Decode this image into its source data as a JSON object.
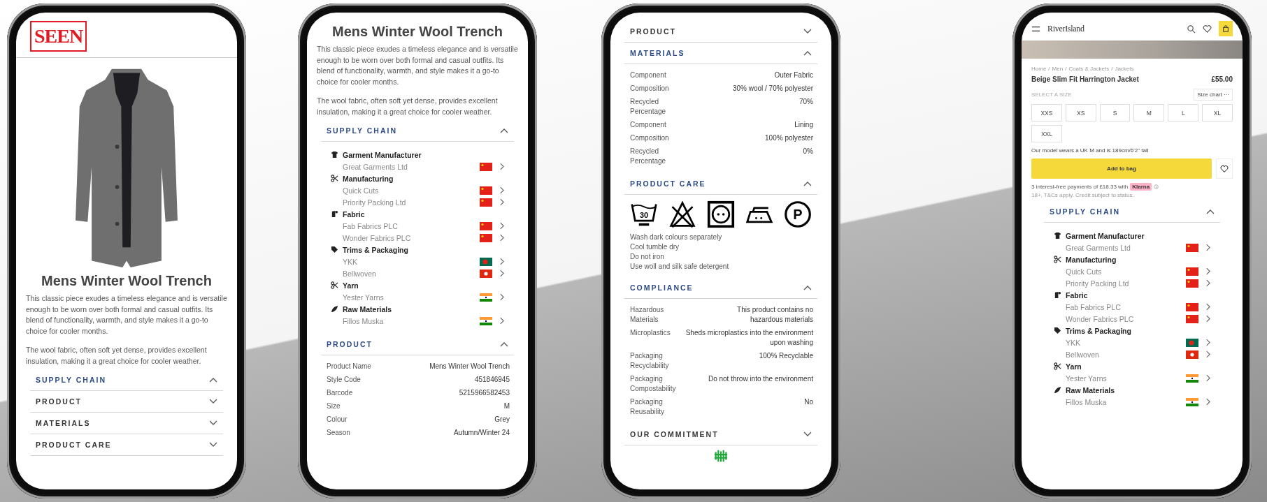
{
  "phones": [
    {
      "blocks": [
        {
          "kind": "logo_header",
          "logo": "SEEN"
        },
        {
          "kind": "coat"
        },
        {
          "kind": "title",
          "text": "Mens Winter Wool Trench"
        },
        {
          "kind": "paragraphs",
          "items": [
            "This classic piece exudes a timeless elegance and is versatile enough to be worn over both formal and casual outfits. Its blend of functionality, warmth, and style makes it a go-to choice for cooler months.",
            "The wool fabric, often soft yet dense, provides excellent insulation, making it a great choice for cooler weather."
          ]
        },
        {
          "kind": "section",
          "title": "SUPPLY CHAIN",
          "expanded": true
        },
        {
          "kind": "section",
          "title": "PRODUCT",
          "expanded": false
        },
        {
          "kind": "section",
          "title": "MATERIALS",
          "expanded": false
        },
        {
          "kind": "section",
          "title": "PRODUCT CARE",
          "expanded": false
        }
      ]
    },
    {
      "blocks": [
        {
          "kind": "title",
          "text": "Mens Winter Wool Trench"
        },
        {
          "kind": "paragraphs",
          "items": [
            "This classic piece exudes a timeless elegance and is versatile enough to be worn over both formal and casual outfits. Its blend of functionality, warmth, and style makes it a go-to choice for cooler months.",
            "The wool fabric, often soft yet dense, provides excellent insulation, making it a great choice for cooler weather."
          ]
        },
        {
          "kind": "section",
          "title": "SUPPLY CHAIN",
          "expanded": true,
          "content": {
            "kind": "supply_chain",
            "groups": [
              {
                "kind": "garment",
                "name": "Garment Manufacturer",
                "suppliers": [
                  {
                    "name": "Great Garments Ltd",
                    "kind": "china"
                  }
                ]
              },
              {
                "kind": "scissors",
                "name": "Manufacturing",
                "suppliers": [
                  {
                    "name": "Quick Cuts",
                    "kind": "china"
                  },
                  {
                    "name": "Priority Packing Ltd",
                    "kind": "china"
                  }
                ]
              },
              {
                "kind": "fabric",
                "name": "Fabric",
                "suppliers": [
                  {
                    "name": "Fab Fabrics PLC",
                    "kind": "china"
                  },
                  {
                    "name": "Wonder Fabrics PLC",
                    "kind": "china"
                  }
                ]
              },
              {
                "kind": "tag",
                "name": "Trims & Packaging",
                "suppliers": [
                  {
                    "name": "YKK",
                    "kind": "bangladesh"
                  },
                  {
                    "name": "Bellwoven",
                    "kind": "hong_kong"
                  }
                ]
              },
              {
                "kind": "scissors",
                "name": "Yarn",
                "suppliers": [
                  {
                    "name": "Yester Yarns",
                    "kind": "india"
                  }
                ]
              },
              {
                "kind": "leaf",
                "name": "Raw Materials",
                "suppliers": [
                  {
                    "name": "Fillos Muska",
                    "kind": "india"
                  }
                ]
              }
            ]
          }
        },
        {
          "kind": "section",
          "title": "PRODUCT",
          "expanded": true,
          "content": {
            "kind": "properties",
            "rows": [
              {
                "label": "Product Name",
                "value": "Mens Winter Wool Trench"
              },
              {
                "label": "Style Code",
                "value": "451846945"
              },
              {
                "label": "Barcode",
                "value": "5215966582453"
              },
              {
                "label": "Size",
                "value": "M"
              },
              {
                "label": "Colour",
                "value": "Grey"
              },
              {
                "label": "Season",
                "value": "Autumn/Winter 24"
              }
            ]
          }
        }
      ]
    },
    {
      "blocks": [
        {
          "kind": "section",
          "title": "PRODUCT",
          "expanded": false
        },
        {
          "kind": "section",
          "title": "MATERIALS",
          "expanded": true,
          "content": {
            "kind": "properties",
            "rows": [
              {
                "label": "Component",
                "value": "Outer Fabric"
              },
              {
                "label": "Composition",
                "value": "30% wool / 70% polyester"
              },
              {
                "label": "Recycled Percentage",
                "value": "70%"
              },
              {
                "label": "Component",
                "value": "Lining"
              },
              {
                "label": "Composition",
                "value": "100% polyester"
              },
              {
                "label": "Recycled Percentage",
                "value": "0%"
              }
            ]
          }
        },
        {
          "kind": "section",
          "title": "PRODUCT CARE",
          "expanded": true,
          "content": {
            "kind": "care",
            "symbols": [
              {
                "kind": "wash",
                "label": "30"
              },
              {
                "kind": "no_bleach"
              },
              {
                "kind": "tumble_dry"
              },
              {
                "kind": "iron"
              },
              {
                "kind": "dry_clean",
                "label": "P"
              }
            ],
            "lines": [
              "Wash dark colours separately",
              "Cool tumble dry",
              "Do not iron",
              "Use woll and silk safe detergent"
            ]
          }
        },
        {
          "kind": "section",
          "title": "COMPLIANCE",
          "expanded": true,
          "content": {
            "kind": "properties",
            "rows": [
              {
                "label": "Hazardous Materials",
                "value": "This product contains no hazardous materials"
              },
              {
                "label": "Microplastics",
                "value": "Sheds microplastics into the environment upon washing"
              },
              {
                "label": "Packaging Recyclability",
                "value": "100% Recyclable"
              },
              {
                "label": "Packaging Compostability",
                "value": "Do not throw into the environment"
              },
              {
                "label": "Packaging Reusability",
                "value": "No"
              }
            ]
          }
        },
        {
          "kind": "section",
          "title": "OUR COMMITMENT",
          "expanded": false
        },
        {
          "kind": "footer_logo"
        }
      ]
    },
    {
      "blocks": [
        {
          "kind": "store_header",
          "brand": "RiverIsland"
        },
        {
          "kind": "photo_strip"
        },
        {
          "kind": "breadcrumb",
          "items": [
            "Home",
            "/",
            "Men",
            "/",
            "Coats & Jackets",
            "/",
            "Jackets"
          ]
        },
        {
          "kind": "product_heading",
          "name": "Beige Slim Fit Harrington Jacket",
          "price": "£55.00"
        },
        {
          "kind": "size_picker",
          "label": "SELECT A SIZE",
          "chart": "Size chart",
          "more": "···",
          "sizes": [
            {
              "label": "XXS",
              "selected": false
            },
            {
              "label": "XS",
              "selected": false
            },
            {
              "label": "S",
              "selected": false
            },
            {
              "label": "M",
              "selected": false
            },
            {
              "label": "L",
              "selected": false
            },
            {
              "label": "XL",
              "selected": false
            },
            {
              "label": "XXL",
              "selected": false
            }
          ]
        },
        {
          "kind": "note",
          "text": "Our model wears a UK M and is 189cm/6'2\" tall"
        },
        {
          "kind": "bag_row",
          "button": "Add to bag"
        },
        {
          "kind": "payment",
          "text": "3 interest-free payments of £18.33 with",
          "badge": "Klarna",
          "terms": "18+, T&Cs apply. Credit subject to status."
        },
        {
          "kind": "section",
          "title": "SUPPLY CHAIN",
          "expanded": true,
          "content": {
            "kind": "supply_chain",
            "groups": [
              {
                "kind": "garment",
                "name": "Garment Manufacturer",
                "suppliers": [
                  {
                    "name": "Great Garments Ltd",
                    "kind": "china"
                  }
                ]
              },
              {
                "kind": "scissors",
                "name": "Manufacturing",
                "suppliers": [
                  {
                    "name": "Quick Cuts",
                    "kind": "china"
                  },
                  {
                    "name": "Priority Packing Ltd",
                    "kind": "china"
                  }
                ]
              },
              {
                "kind": "fabric",
                "name": "Fabric",
                "suppliers": [
                  {
                    "name": "Fab Fabrics PLC",
                    "kind": "china"
                  },
                  {
                    "name": "Wonder Fabrics PLC",
                    "kind": "china"
                  }
                ]
              },
              {
                "kind": "tag",
                "name": "Trims & Packaging",
                "suppliers": [
                  {
                    "name": "YKK",
                    "kind": "bangladesh"
                  },
                  {
                    "name": "Bellwoven",
                    "kind": "hong_kong"
                  }
                ]
              },
              {
                "kind": "scissors",
                "name": "Yarn",
                "suppliers": [
                  {
                    "name": "Yester Yarns",
                    "kind": "india"
                  }
                ]
              },
              {
                "kind": "leaf",
                "name": "Raw Materials",
                "suppliers": [
                  {
                    "name": "Fillos Muska",
                    "kind": "india"
                  }
                ]
              }
            ]
          }
        }
      ]
    }
  ]
}
